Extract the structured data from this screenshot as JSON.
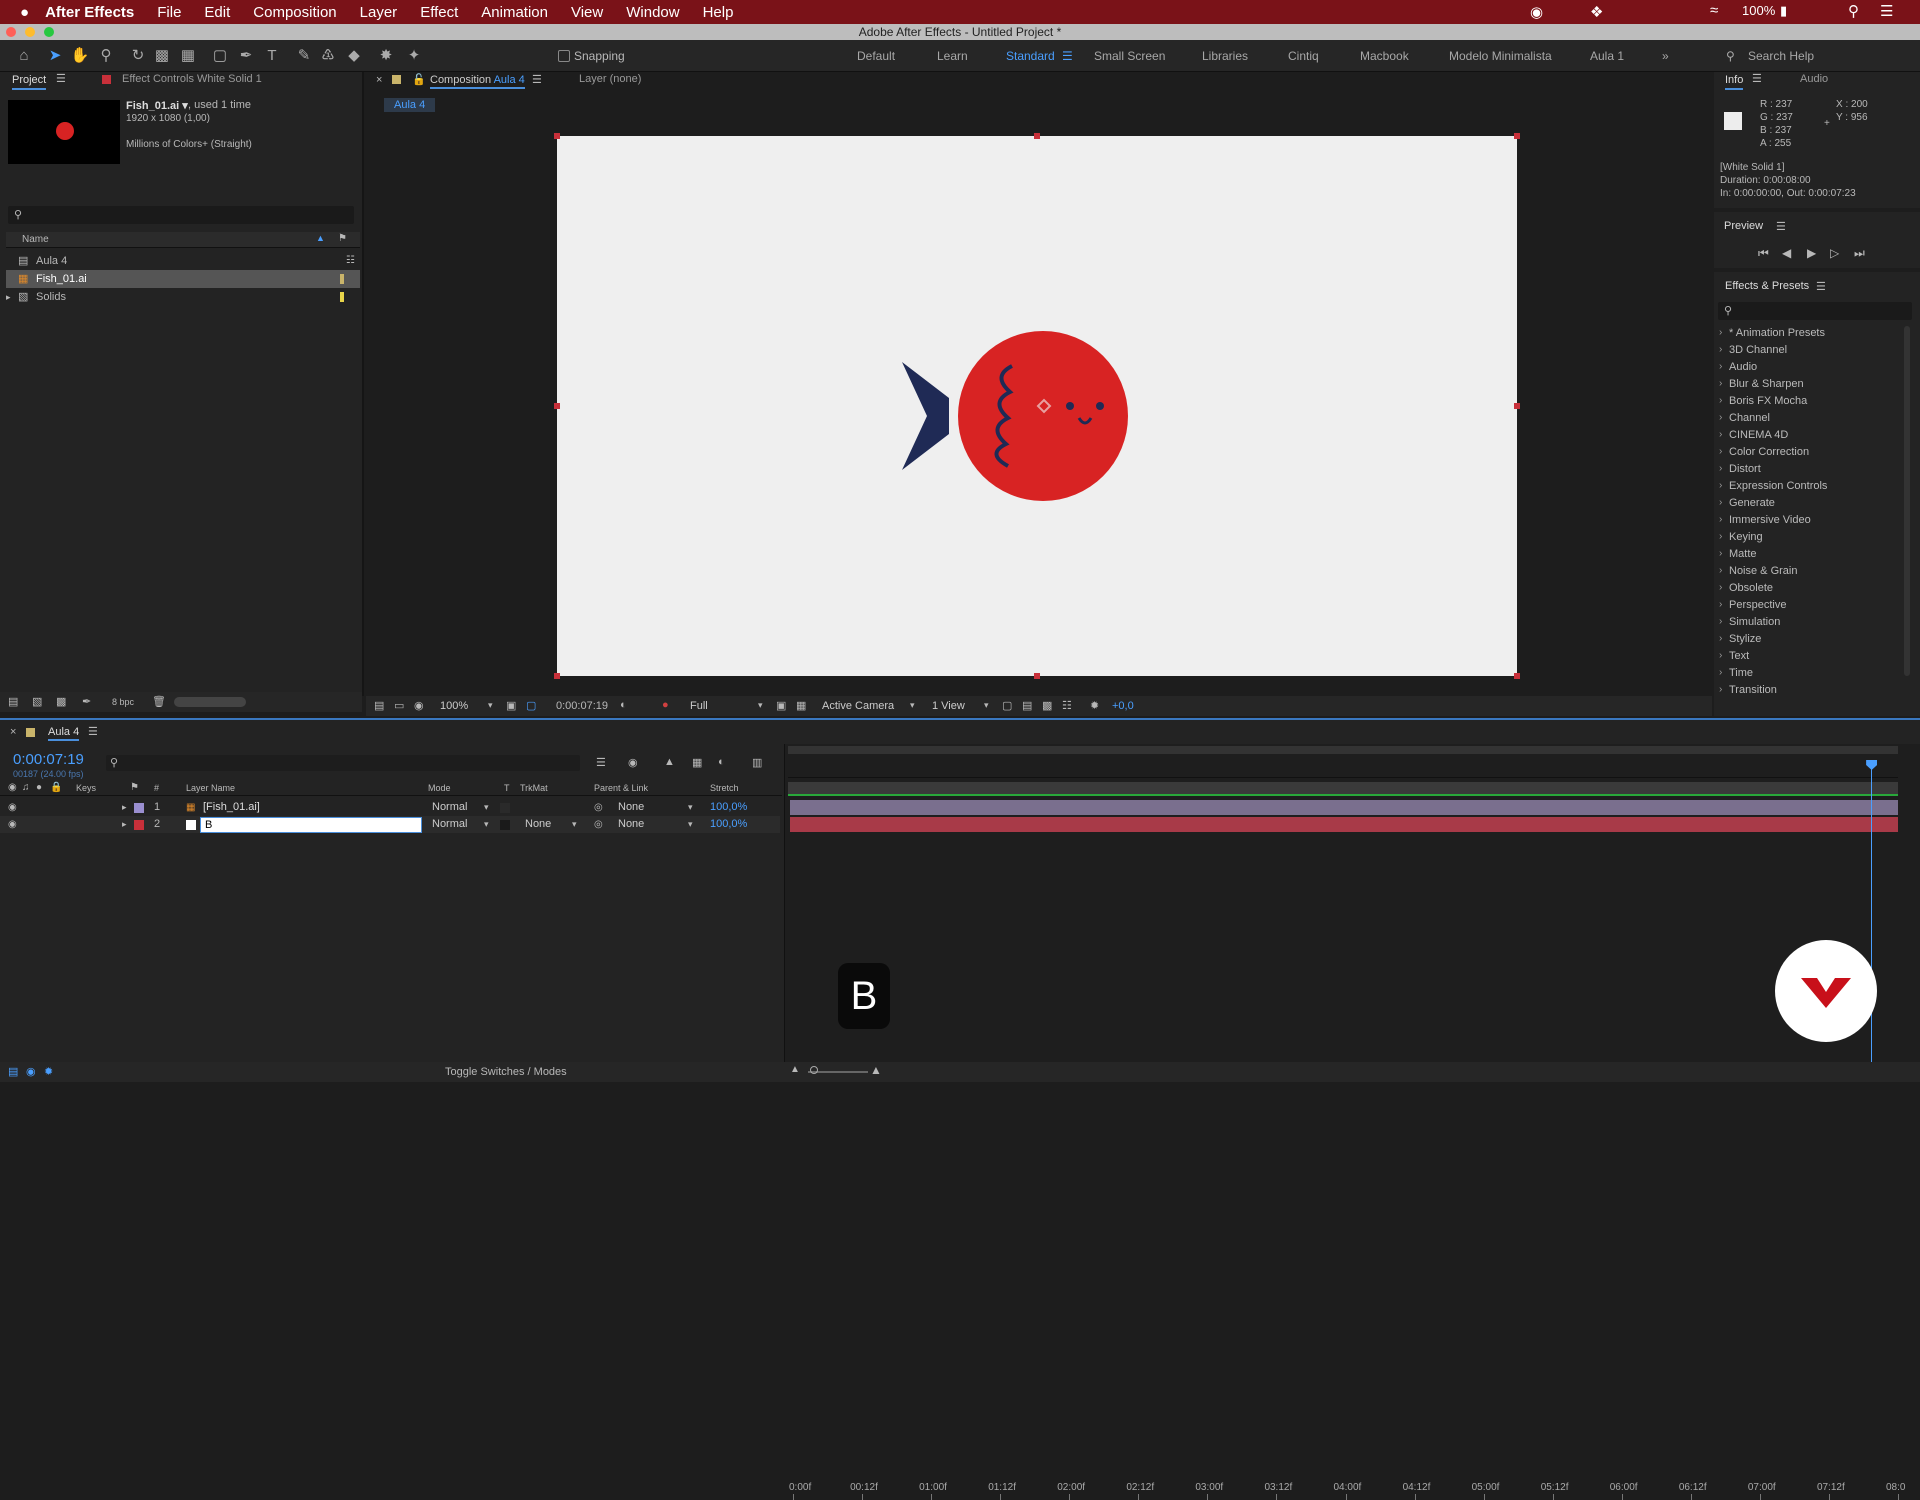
{
  "menubar": {
    "apple_icon": "apple-icon",
    "app": "After Effects",
    "items": [
      "File",
      "Edit",
      "Composition",
      "Layer",
      "Effect",
      "Animation",
      "View",
      "Window",
      "Help"
    ],
    "battery": "100%"
  },
  "window": {
    "title": "Adobe After Effects - Untitled Project *"
  },
  "toolbar": {
    "snapping": "Snapping",
    "workspaces": [
      "Default",
      "Learn",
      "Standard",
      "Small Screen",
      "Libraries",
      "Cintiq",
      "Macbook",
      "Modelo Minimalista",
      "Aula 1"
    ],
    "active_workspace": "Standard",
    "search_placeholder": "Search Help"
  },
  "project": {
    "tab": "Project",
    "effect_controls_tab": "Effect Controls White Solid 1",
    "thumb_name": "Fish_01.ai ▾",
    "thumb_used": ", used 1 time",
    "thumb_dims": "1920 x 1080 (1,00)",
    "thumb_color": "Millions of Colors+ (Straight)",
    "col_name": "Name",
    "items": [
      {
        "name": "Aula 4",
        "color": "#c9b46a"
      },
      {
        "name": "Fish_01.ai",
        "color": "#c9b46a"
      },
      {
        "name": "Solids",
        "color": "#e8d44a"
      }
    ],
    "bpc": "8 bpc"
  },
  "composition": {
    "tab": "Composition",
    "tab_name": "Aula 4",
    "layer_tab": "Layer (none)",
    "crumb": "Aula 4",
    "zoom": "100%",
    "timecode": "0:00:07:19",
    "resolution": "Full",
    "camera": "Active Camera",
    "views": "1 View",
    "exposure": "+0,0",
    "bg": "#efefef",
    "fish_body": "#d82323",
    "fish_tail": "#1f2a55"
  },
  "info": {
    "tab": "Info",
    "audio_tab": "Audio",
    "r": "R : 237",
    "g": "G : 237",
    "b": "B : 237",
    "a": "A : 255",
    "x": "X : 200",
    "y": "Y : 956",
    "layer": "[White Solid 1]",
    "duration": "Duration: 0:00:08:00",
    "inout": "In: 0:00:00:00, Out: 0:00:07:23"
  },
  "preview": {
    "title": "Preview"
  },
  "effects": {
    "title": "Effects & Presets",
    "items": [
      "* Animation Presets",
      "3D Channel",
      "Audio",
      "Blur & Sharpen",
      "Boris FX Mocha",
      "Channel",
      "CINEMA 4D",
      "Color Correction",
      "Distort",
      "Expression Controls",
      "Generate",
      "Immersive Video",
      "Keying",
      "Matte",
      "Noise & Grain",
      "Obsolete",
      "Perspective",
      "Simulation",
      "Stylize",
      "Text",
      "Time",
      "Transition"
    ]
  },
  "timeline": {
    "tab": "Aula 4",
    "timecode": "0:00:07:19",
    "frames": "00187 (24.00 fps)",
    "cols": {
      "keys": "Keys",
      "num": "#",
      "name": "Layer Name",
      "mode": "Mode",
      "t": "T",
      "trkmat": "TrkMat",
      "parent": "Parent & Link",
      "stretch": "Stretch"
    },
    "ticks": [
      "0:00f",
      "00:12f",
      "01:00f",
      "01:12f",
      "02:00f",
      "02:12f",
      "03:00f",
      "03:12f",
      "04:00f",
      "04:12f",
      "05:00f",
      "05:12f",
      "06:00f",
      "06:12f",
      "07:00f",
      "07:12f",
      "08:0"
    ],
    "layers": [
      {
        "num": "1",
        "name": "[Fish_01.ai]",
        "mode": "Normal",
        "trkmat": "",
        "parent": "None",
        "stretch": "100,0%",
        "label": "#9a8fd0",
        "bar": "#7a6f8e"
      },
      {
        "num": "2",
        "name": "B",
        "mode": "Normal",
        "trkmat": "None",
        "parent": "None",
        "stretch": "100,0%",
        "label": "#c8303a",
        "bar": "#a83a48"
      }
    ],
    "toggle": "Toggle Switches / Modes",
    "playhead_fraction": 0.9758
  },
  "overlay": {
    "key": "B"
  }
}
